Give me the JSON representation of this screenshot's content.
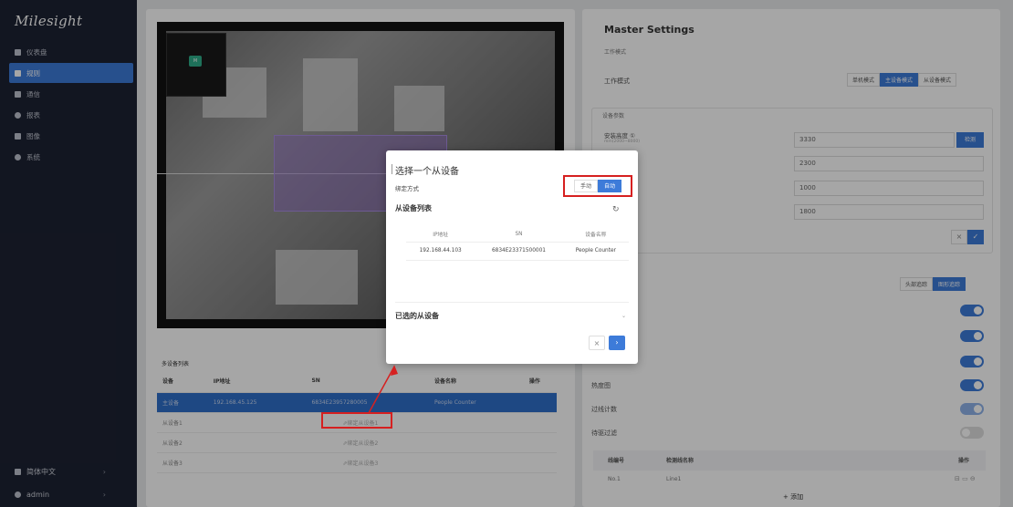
{
  "brand": "Milesight",
  "sidebar": {
    "items": [
      {
        "label": "仪表盘",
        "icon": "dashboard-icon",
        "active": false
      },
      {
        "label": "规则",
        "icon": "rules-icon",
        "active": true
      },
      {
        "label": "通信",
        "icon": "communication-icon",
        "active": false
      },
      {
        "label": "报表",
        "icon": "report-icon",
        "active": false
      },
      {
        "label": "图像",
        "icon": "image-icon",
        "active": false
      },
      {
        "label": "系统",
        "icon": "system-icon",
        "active": false
      }
    ],
    "language": "简体中文",
    "user": "admin"
  },
  "video": {
    "pip_label": "M"
  },
  "device_list": {
    "title": "多设备列表",
    "columns": [
      "设备",
      "IP地址",
      "SN",
      "设备名称",
      "操作"
    ],
    "rows": [
      {
        "device": "主设备",
        "ip": "192.168.45.125",
        "sn": "6834E23957280005",
        "name": "People Counter",
        "op": ""
      },
      {
        "device": "从设备1",
        "ip": "",
        "sn": "",
        "name": "",
        "op": "",
        "bind": "⇗绑定从设备1"
      },
      {
        "device": "从设备2",
        "ip": "",
        "sn": "",
        "name": "",
        "op": "",
        "bind": "⇗绑定从设备2"
      },
      {
        "device": "从设备3",
        "ip": "",
        "sn": "",
        "name": "",
        "op": "",
        "bind": "⇗绑定从设备3"
      }
    ]
  },
  "settings": {
    "title": "Master Settings",
    "work_mode_section": "工作模式",
    "work_mode_label": "工作模式",
    "work_modes": [
      "单机模式",
      "主设备模式",
      "从设备模式"
    ],
    "active_mode": 1,
    "device_params_section": "设备参数",
    "install_height_label": "安装高度 ①",
    "install_height_hint": "mm(2000~8000)",
    "fields": [
      "3330",
      "2300",
      "1000",
      "1800"
    ],
    "detect_label": "检测",
    "detect_modes": [
      "头部追踪",
      "图形追踪"
    ],
    "heatmap_label": "热度图",
    "line_count_label": "过线计数",
    "child_filter_label": "待驱过滤",
    "line_table": {
      "columns": [
        "线编号",
        "检测线名称",
        "操作"
      ],
      "rows": [
        {
          "no": "No.1",
          "name": "Line1"
        }
      ]
    },
    "add_label": "+ 添加"
  },
  "modal": {
    "title": "选择一个从设备",
    "bind_label": "绑定方式",
    "bind_options": [
      "手动",
      "自动"
    ],
    "bind_active": 1,
    "list_title": "从设备列表",
    "columns": [
      "IP地址",
      "SN",
      "设备名称"
    ],
    "rows": [
      {
        "ip": "192.168.44.103",
        "sn": "6834E23371500001",
        "name": "People Counter"
      }
    ],
    "selected_title": "已选的从设备",
    "chev": "⌄"
  }
}
